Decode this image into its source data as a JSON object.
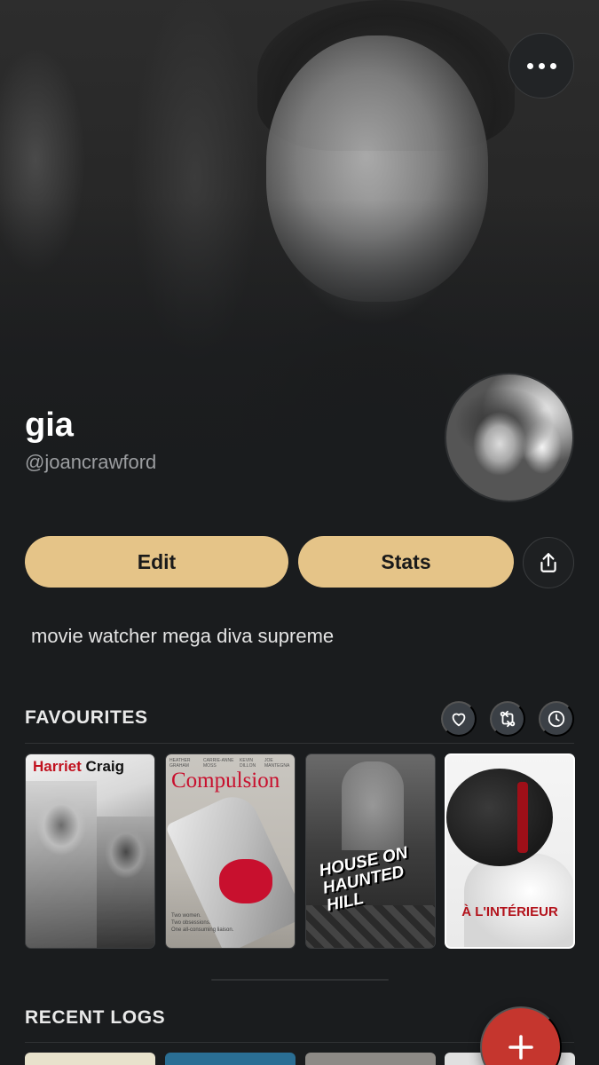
{
  "profile": {
    "name": "gia",
    "handle": "@joancrawford",
    "bio": "movie watcher mega diva supreme"
  },
  "actions": {
    "edit_label": "Edit",
    "stats_label": "Stats"
  },
  "favourites": {
    "title": "FAVOURITES",
    "posters": [
      {
        "title_red": "Harriet",
        "title_dark": "Craig"
      },
      {
        "title": "Compulsion",
        "cast": [
          "HEATHER GRAHAM",
          "CARRIE-ANNE MOSS",
          "KEVIN DILLON",
          "JOE MANTEGNA"
        ],
        "tagline": [
          "Two women.",
          "Two obsessions.",
          "One all-consuming liaison."
        ]
      },
      {
        "title": "HOUSE ON HAUNTED HILL"
      },
      {
        "title": "À L'INTÉRIEUR"
      }
    ]
  },
  "recent": {
    "title": "RECENT LOGS"
  },
  "colors": {
    "background": "#1a1c1e",
    "accent": "#e5c488",
    "fab": "#c5362e"
  },
  "icons": {
    "more": "more-dots-icon",
    "share": "share-icon",
    "favourite": "heart-icon",
    "reorder": "swap-icon",
    "history": "clock-icon",
    "add": "plus-icon"
  }
}
